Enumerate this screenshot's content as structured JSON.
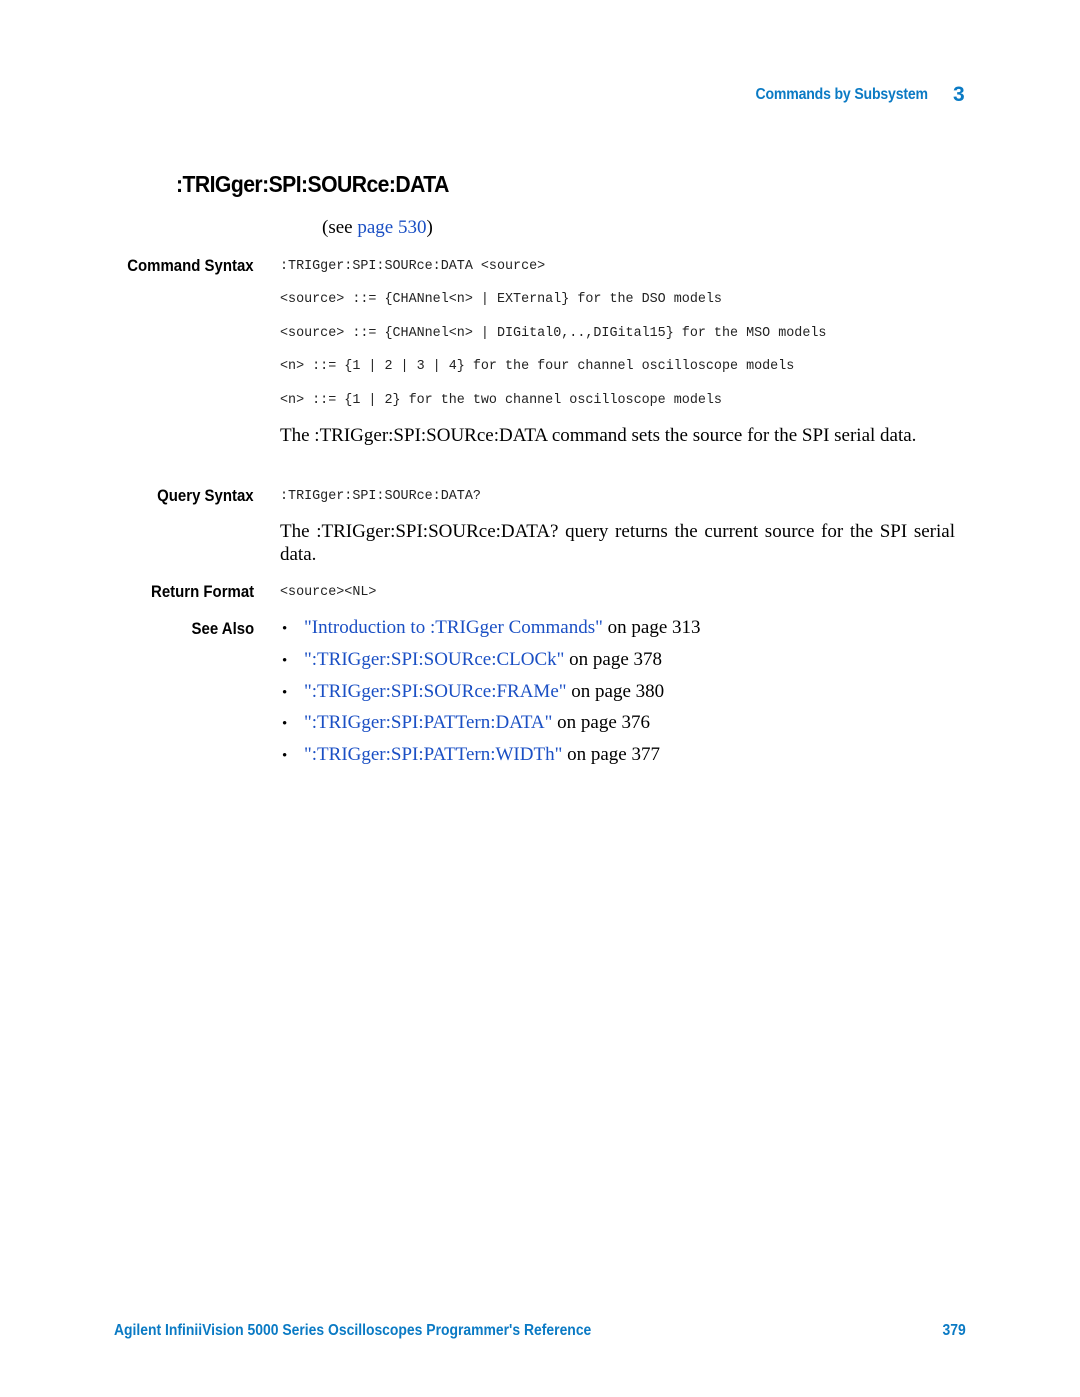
{
  "header": {
    "section": "Commands by Subsystem",
    "chapter": "3"
  },
  "title": ":TRIGger:SPI:SOURce:DATA",
  "see_page": {
    "prefix": "(see ",
    "link_text": "page 530",
    "suffix": ")"
  },
  "command_syntax": {
    "label": "Command Syntax",
    "lines": [
      ":TRIGger:SPI:SOURce:DATA <source>",
      "<source> ::= {CHANnel<n> | EXTernal} for the DSO models",
      "<source> ::= {CHANnel<n> | DIGital0,..,DIGital15} for the MSO models",
      "<n> ::= {1 | 2 | 3 | 4} for the four channel oscilloscope models",
      "<n> ::= {1 | 2} for the two channel oscilloscope models"
    ],
    "description": "The :TRIGger:SPI:SOURce:DATA command sets the source for the SPI serial data."
  },
  "query_syntax": {
    "label": "Query Syntax",
    "line": ":TRIGger:SPI:SOURce:DATA?",
    "description": "The :TRIGger:SPI:SOURce:DATA? query returns the current source for the SPI serial data."
  },
  "return_format": {
    "label": "Return Format",
    "line": "<source><NL>"
  },
  "see_also": {
    "label": "See Also",
    "bullet": "•",
    "items": [
      {
        "link": "\"Introduction to :TRIGger Commands\"",
        "suffix": " on page 313"
      },
      {
        "link": "\":TRIGger:SPI:SOURce:CLOCk\"",
        "suffix": " on page 378"
      },
      {
        "link": "\":TRIGger:SPI:SOURce:FRAMe\"",
        "suffix": " on page 380"
      },
      {
        "link": "\":TRIGger:SPI:PATTern:DATA\"",
        "suffix": " on page 376"
      },
      {
        "link": "\":TRIGger:SPI:PATTern:WIDTh\"",
        "suffix": " on page 377"
      }
    ]
  },
  "footer": {
    "title": "Agilent InfiniiVision 5000 Series Oscilloscopes Programmer's Reference",
    "page_number": "379"
  },
  "colors": {
    "header_blue": "#0a7ac4",
    "link_blue": "#1a4fc4"
  }
}
